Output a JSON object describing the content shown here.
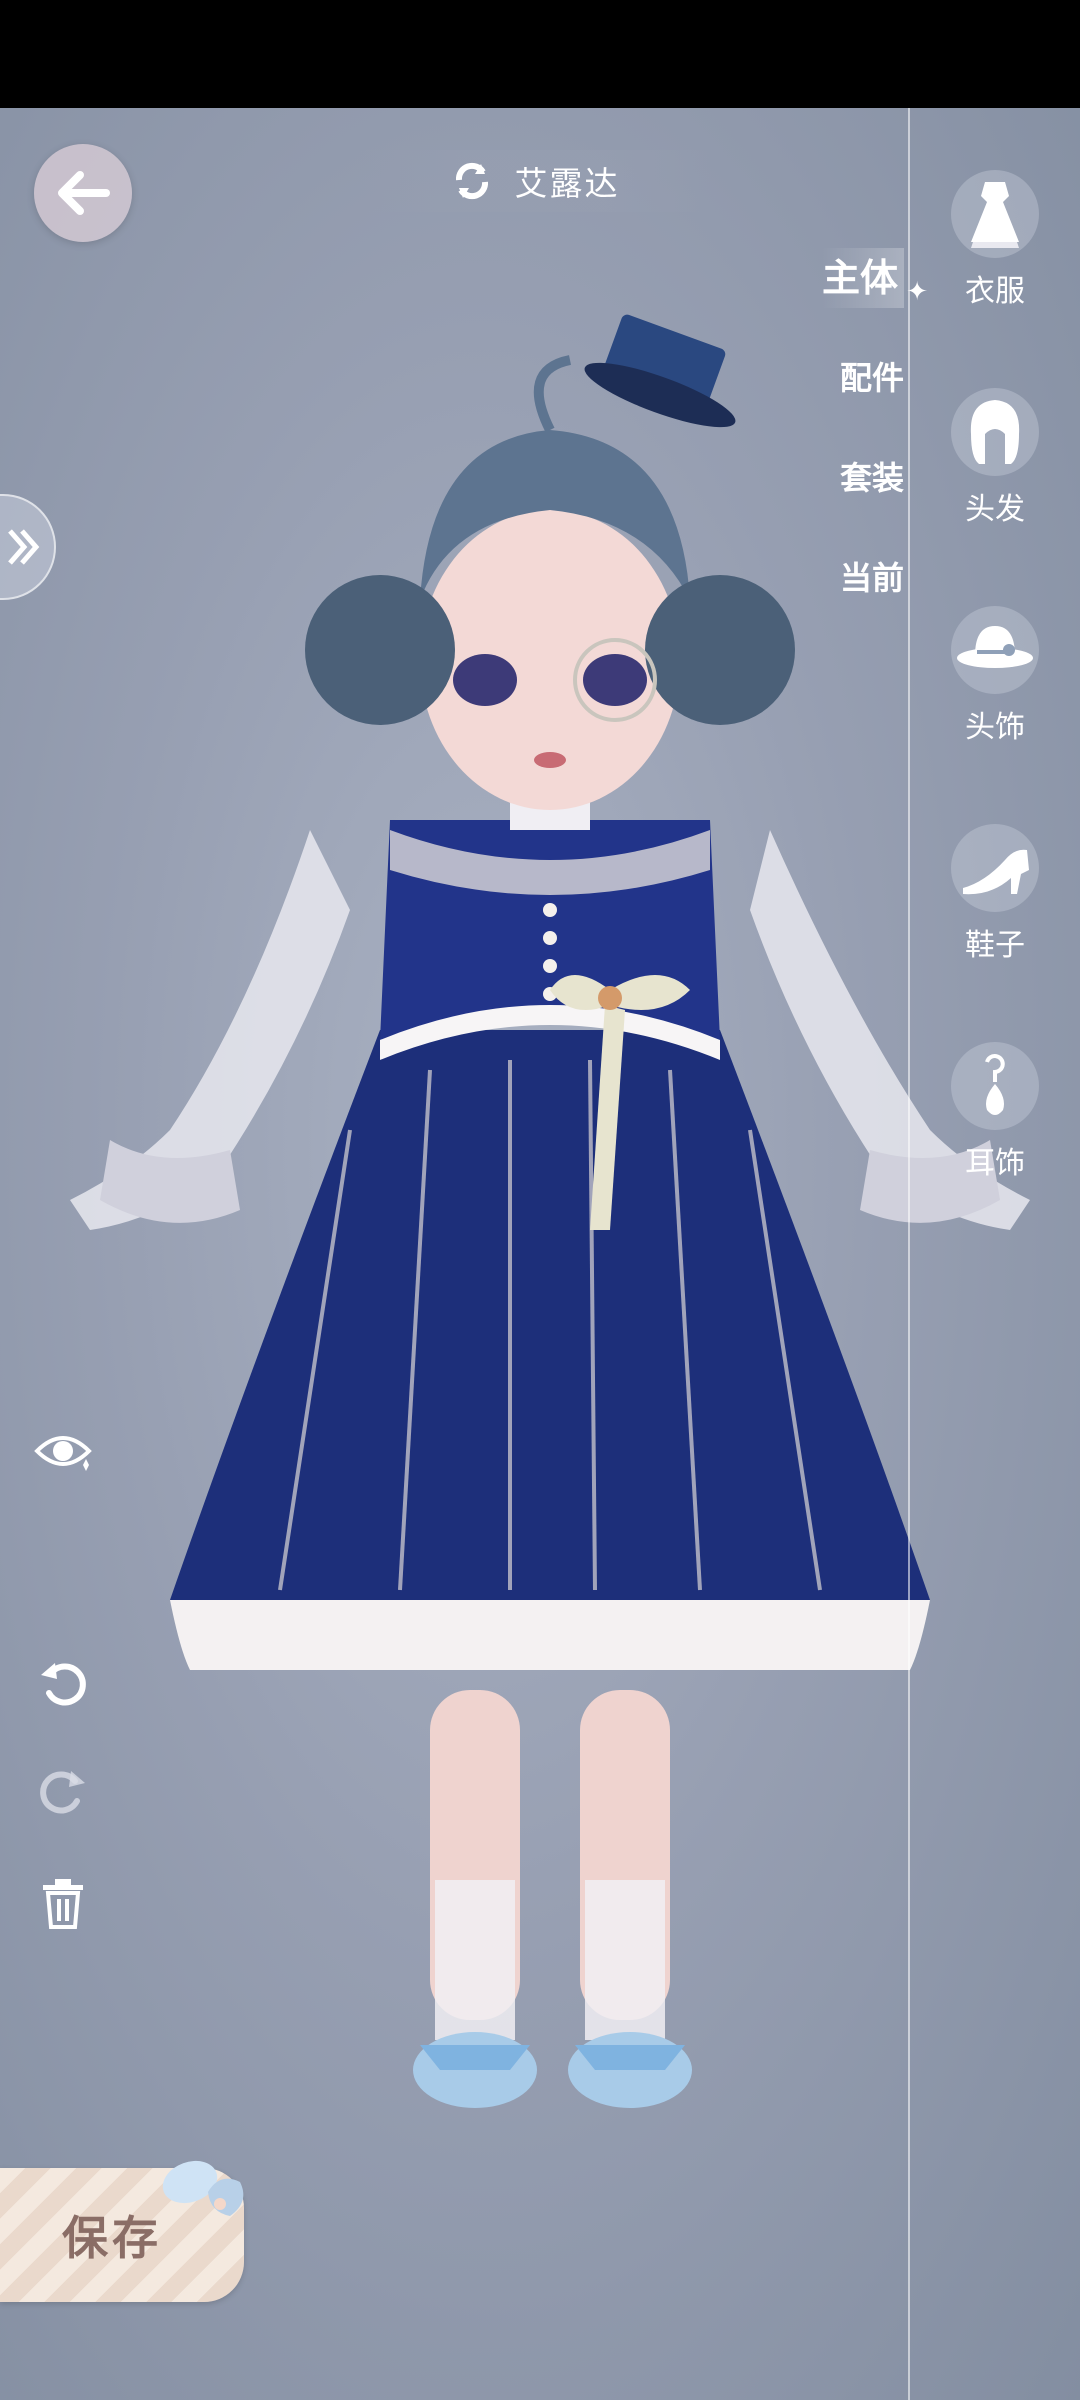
{
  "character_name": "艾露达",
  "category_tabs": [
    {
      "label": "主体",
      "active": true
    },
    {
      "label": "配件",
      "active": false
    },
    {
      "label": "套装",
      "active": false
    },
    {
      "label": "当前",
      "active": false
    }
  ],
  "items": [
    {
      "label": "衣服",
      "icon": "dress-icon"
    },
    {
      "label": "头发",
      "icon": "hair-icon"
    },
    {
      "label": "头饰",
      "icon": "hat-icon"
    },
    {
      "label": "鞋子",
      "icon": "shoe-icon"
    },
    {
      "label": "耳饰",
      "icon": "earring-icon"
    }
  ],
  "save_label": "保存",
  "colors": {
    "dress": "#1d2f7a",
    "hair": "#5d7490",
    "accent_white": "#ffffff"
  }
}
